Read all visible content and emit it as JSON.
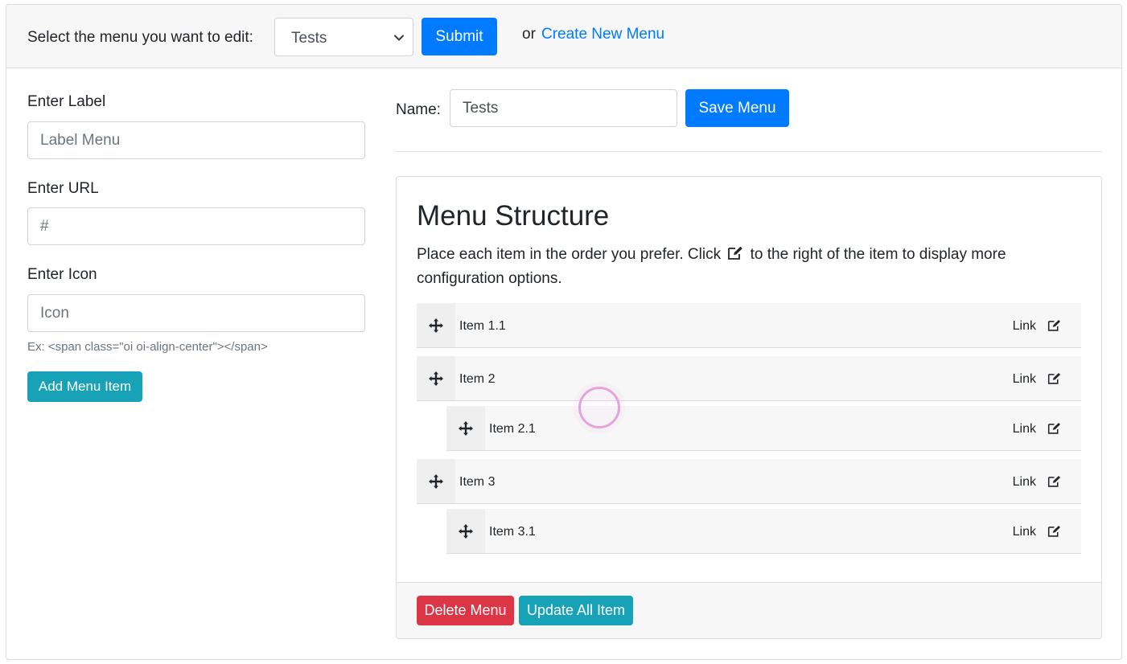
{
  "header": {
    "select_label": "Select the menu you want to edit:",
    "selected_menu": "Tests",
    "submit_label": "Submit",
    "or_text": "or",
    "create_link": "Create New Menu"
  },
  "form": {
    "label_title": "Enter Label",
    "label_placeholder": "Label Menu",
    "url_title": "Enter URL",
    "url_placeholder": "#",
    "icon_title": "Enter Icon",
    "icon_placeholder": "Icon",
    "icon_hint": "Ex: <span class=\"oi oi-align-center\"></span>",
    "add_button": "Add Menu Item"
  },
  "menu_name": {
    "label": "Name:",
    "value": "Tests",
    "save_button": "Save Menu"
  },
  "structure": {
    "title": "Menu Structure",
    "desc_before": "Place each item in the order you prefer. Click",
    "desc_after": "to the right of the item to display more configuration options.",
    "items": [
      {
        "label": "Item 1.1",
        "type": "Link",
        "depth": 0
      },
      {
        "label": "Item 2",
        "type": "Link",
        "depth": 0
      },
      {
        "label": "Item 2.1",
        "type": "Link",
        "depth": 1
      },
      {
        "label": "Item 3",
        "type": "Link",
        "depth": 0
      },
      {
        "label": "Item 3.1",
        "type": "Link",
        "depth": 1
      }
    ],
    "delete_button": "Delete Menu",
    "update_button": "Update All Item"
  },
  "icons": {
    "move": "move-arrows-icon",
    "edit": "edit-square-icon",
    "caret": "chevron-down-icon"
  },
  "colors": {
    "primary": "#007bff",
    "info": "#17a2b8",
    "danger": "#dc3545",
    "cursor_ring": "#e6a3dc"
  }
}
